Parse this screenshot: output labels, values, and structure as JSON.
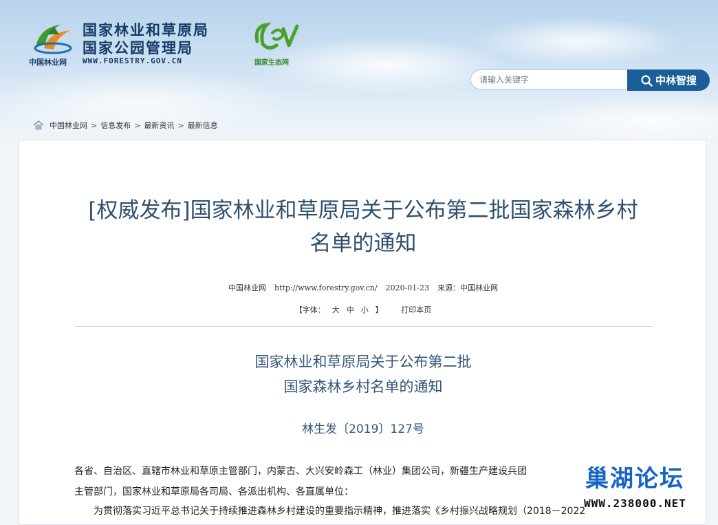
{
  "header": {
    "logo_small": "中国林业网",
    "org_line1": "国家林业和草原局",
    "org_line2": "国家公园管理局",
    "org_url": "WWW.FORESTRY.GOV.CN",
    "eco_label": "国家生态网",
    "search_placeholder": "请输入关键字",
    "search_button": "中林智搜"
  },
  "breadcrumb": [
    "中国林业网",
    "信息发布",
    "最新资讯",
    "最新信息"
  ],
  "article": {
    "title_line1": "[权威发布]国家林业和草原局关于公布第二批国家森林乡村",
    "title_line2": "名单的通知",
    "meta_site": "中国林业网",
    "meta_url": "http://www.forestry.gov.cn/",
    "meta_date": "2020-01-23",
    "meta_source": "来源：中国林业网",
    "font_label": "【字体：",
    "font_large": "大",
    "font_medium": "中",
    "font_small": "小",
    "font_close": "】",
    "print_label": "打印本页",
    "doc_title_line1": "国家林业和草原局关于公布第二批",
    "doc_title_line2": "国家森林乡村名单的通知",
    "doc_number": "林生发〔2019〕127号",
    "para1": "各省、自治区、直辖市林业和草原主管部门，内蒙古、大兴安岭森工（林业）集团公司，新疆生产建设兵团",
    "para2": "主管部门，国家林业和草原局各司局、各派出机构、各直属单位：",
    "para3": "为贯彻落实习近平总书记关于持续推进森林乡村建设的重要指示精神，推进落实《乡村振兴战略规划（2018－2022"
  },
  "watermark": {
    "title": "巢湖论坛",
    "url": "WWW.238000.NET"
  },
  "colors": {
    "brand_blue": "#1b5f98",
    "title_text": "#2d4f70",
    "watermark_blue": "#1565c8"
  }
}
